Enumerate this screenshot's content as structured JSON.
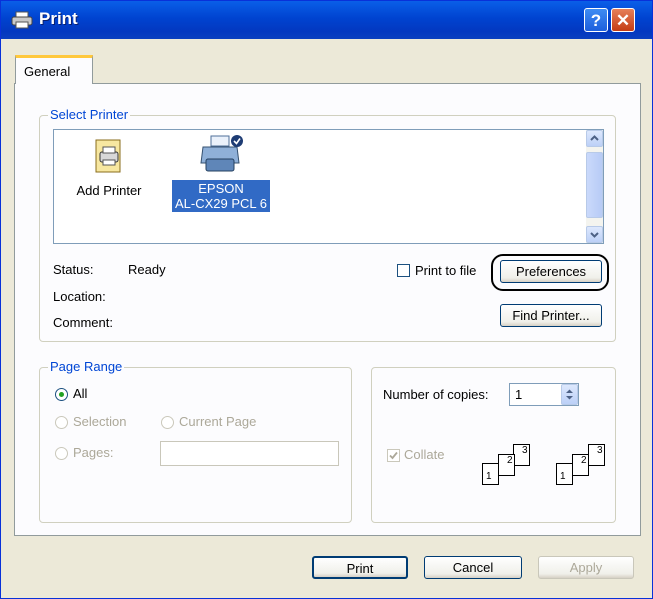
{
  "window": {
    "title": "Print"
  },
  "title_buttons": {
    "help": "?",
    "close": "✕"
  },
  "tabs": [
    {
      "label": "General"
    }
  ],
  "select_printer": {
    "group_label": "Select Printer",
    "printers": [
      {
        "label": "Add Printer",
        "icon": "add-printer-icon",
        "selected": false
      },
      {
        "label_line1": "EPSON",
        "label_line2": "AL-CX29 PCL 6",
        "icon": "printer-icon",
        "selected": true
      }
    ],
    "status_label": "Status:",
    "status_value": "Ready",
    "location_label": "Location:",
    "location_value": "",
    "comment_label": "Comment:",
    "comment_value": "",
    "print_to_file_label": "Print to file",
    "print_to_file_checked": false,
    "preferences_button": "Preferences",
    "find_printer_button": "Find Printer..."
  },
  "page_range": {
    "group_label": "Page Range",
    "options": {
      "all": "All",
      "selection": "Selection",
      "current_page": "Current Page",
      "pages": "Pages:"
    },
    "selected": "all",
    "pages_value": ""
  },
  "copies": {
    "label": "Number of copies:",
    "value": "1",
    "collate_label": "Collate",
    "collate_checked": true,
    "collate_pages": [
      "1",
      "2",
      "3"
    ]
  },
  "footer": {
    "print_button": "Print",
    "cancel_button": "Cancel",
    "apply_button": "Apply"
  },
  "colors": {
    "titlebar": "#0043d0",
    "dialog_bg": "#ece9d8",
    "selection": "#316ac5",
    "group_label": "#0046d5"
  }
}
